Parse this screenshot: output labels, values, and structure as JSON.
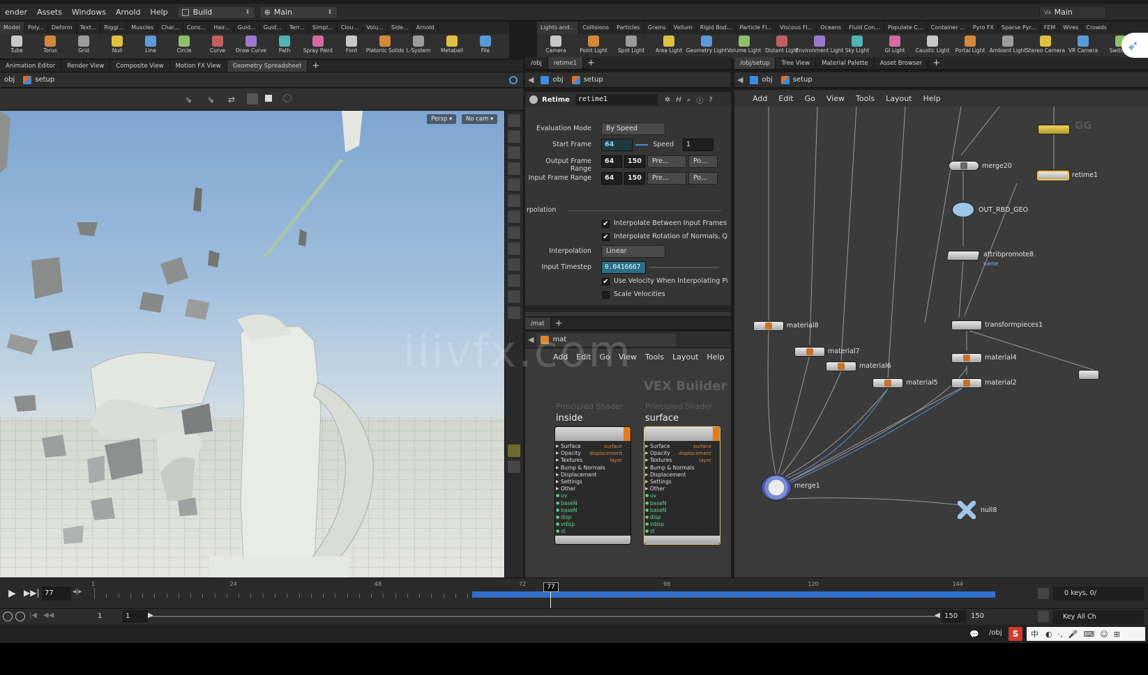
{
  "menu": {
    "items": [
      "ender",
      "Assets",
      "Windows",
      "Arnold",
      "Help"
    ],
    "desktop": "Build",
    "context": "Main",
    "right_context": "Main",
    "right_context_prefix": "Vik"
  },
  "shelf_left": {
    "tabs": [
      "Model",
      "Poly...",
      "Deform",
      "Text...",
      "Riggi...",
      "Muscles",
      "Char...",
      "Cons...",
      "Hair...",
      "Guid...",
      "Guid...",
      "Terr...",
      "Simpl...",
      "Clou...",
      "Volu...",
      "Side...",
      "Arnold"
    ],
    "tools": [
      "Tube",
      "Torus",
      "Grid",
      "Null",
      "Line",
      "Circle",
      "Curve",
      "Draw Curve",
      "Path",
      "Spray Paint",
      "Font",
      "Platonic Solids",
      "L-System",
      "Metaball",
      "File"
    ]
  },
  "shelf_right": {
    "tabs": [
      "Lights and...",
      "Collisions",
      "Particles",
      "Grains",
      "Vellum",
      "Rigid Bod...",
      "Particle Fl...",
      "Viscous Fl...",
      "Oceans",
      "Fluid Con...",
      "Populate C...",
      "Container ...",
      "Pyro FX",
      "Sparse Pyr...",
      "FEM",
      "Wires",
      "Crowds"
    ],
    "tools": [
      "Camera",
      "Point Light",
      "Spot Light",
      "Area Light",
      "Geometry Light",
      "Volume Light",
      "Distant Light",
      "Environment Light",
      "Sky Light",
      "GI Light",
      "Caustic Light",
      "Portal Light",
      "Ambient Light",
      "Stereo Camera",
      "VR Camera",
      "Switcher"
    ]
  },
  "left_pane": {
    "tabs": [
      "Animation Editor",
      "Render View",
      "Composite View",
      "Motion FX View",
      "Geometry Spreadsheet"
    ],
    "path": [
      "obj",
      "setup"
    ],
    "persp": "Persp",
    "cam": "No cam"
  },
  "mid_pane": {
    "tabs": [
      "/obj",
      "retime1"
    ],
    "path": [
      "obj",
      "setup"
    ],
    "node_type": "Retime",
    "node_name": "retime1",
    "params": {
      "evaluation_mode_label": "Evaluation Mode",
      "evaluation_mode": "By Speed",
      "start_frame_label": "Start Frame",
      "start_frame": "64",
      "speed_label": "Speed",
      "speed": "1",
      "output_range_label": "Output Frame Range",
      "output_start": "64",
      "output_end": "150",
      "input_range_label": "Input Frame Range",
      "input_start": "64",
      "input_end": "150",
      "pre_label": "Pre...",
      "post_label": "Po...",
      "section_label": "rpolation",
      "interp_between": "Interpolate Between Input Frames",
      "interp_rotation": "Interpolate Rotation of Normals, Q",
      "interpolation_label": "Interpolation",
      "interpolation": "Linear",
      "timestep_label": "Input Timestep",
      "timestep": "0.0416667",
      "use_velocity": "Use Velocity When Interpolating Pi",
      "scale_velocities": "Scale Velocities"
    }
  },
  "mat_pane": {
    "tab": "/mat",
    "path": "mat",
    "menu": [
      "Add",
      "Edit",
      "Go",
      "View",
      "Tools",
      "Layout",
      "Help"
    ],
    "watermark_label": "VEX Builder",
    "shader_type": "Principled Shader",
    "shaders": [
      {
        "name": "inside"
      },
      {
        "name": "surface"
      }
    ],
    "inputs": [
      "Surface",
      "Opacity",
      "Textures",
      "Bump & Normals",
      "Displacement",
      "Settings",
      "Other"
    ],
    "extra_inputs": [
      "uv",
      "baseN",
      "baseN",
      "disp",
      "vdisp",
      "st"
    ],
    "outputs": [
      "surface",
      "displacement",
      "layer"
    ]
  },
  "net_pane": {
    "tabs": [
      "/obj/setup",
      "Tree View",
      "Material Palette",
      "Asset Browser"
    ],
    "path": [
      "obj",
      "setup"
    ],
    "menu": [
      "Add",
      "Edit",
      "Go",
      "View",
      "Tools",
      "Layout",
      "Help"
    ],
    "nodes": [
      {
        "name": "merge20"
      },
      {
        "name": "OUT_RBD_GEO"
      },
      {
        "name": "attribpromote8",
        "sub": "name"
      },
      {
        "name": "transformpieces1"
      },
      {
        "name": "material4"
      },
      {
        "name": "material2"
      },
      {
        "name": "material5"
      },
      {
        "name": "material6"
      },
      {
        "name": "material7"
      },
      {
        "name": "material8"
      },
      {
        "name": "merge1"
      },
      {
        "name": "null8"
      },
      {
        "name": "retime1"
      },
      {
        "name": "GG"
      }
    ]
  },
  "timeline": {
    "current_frame": "77",
    "marker": "77",
    "ticks": [
      "1",
      "24",
      "48",
      "72",
      "96",
      "120",
      "144"
    ],
    "range_start": "1",
    "range_start2": "1",
    "range_end": "150",
    "range_end2": "150",
    "keys": "0 keys, 0/",
    "key_all": "Key All Ch"
  },
  "status": {
    "path": "/obj",
    "ime": "中"
  },
  "watermark": "iiivfx.com",
  "colors": {
    "accent_blue": "#2e6fd0",
    "node_orange": "#c9722c",
    "selected_yellow": "#f2c531"
  }
}
